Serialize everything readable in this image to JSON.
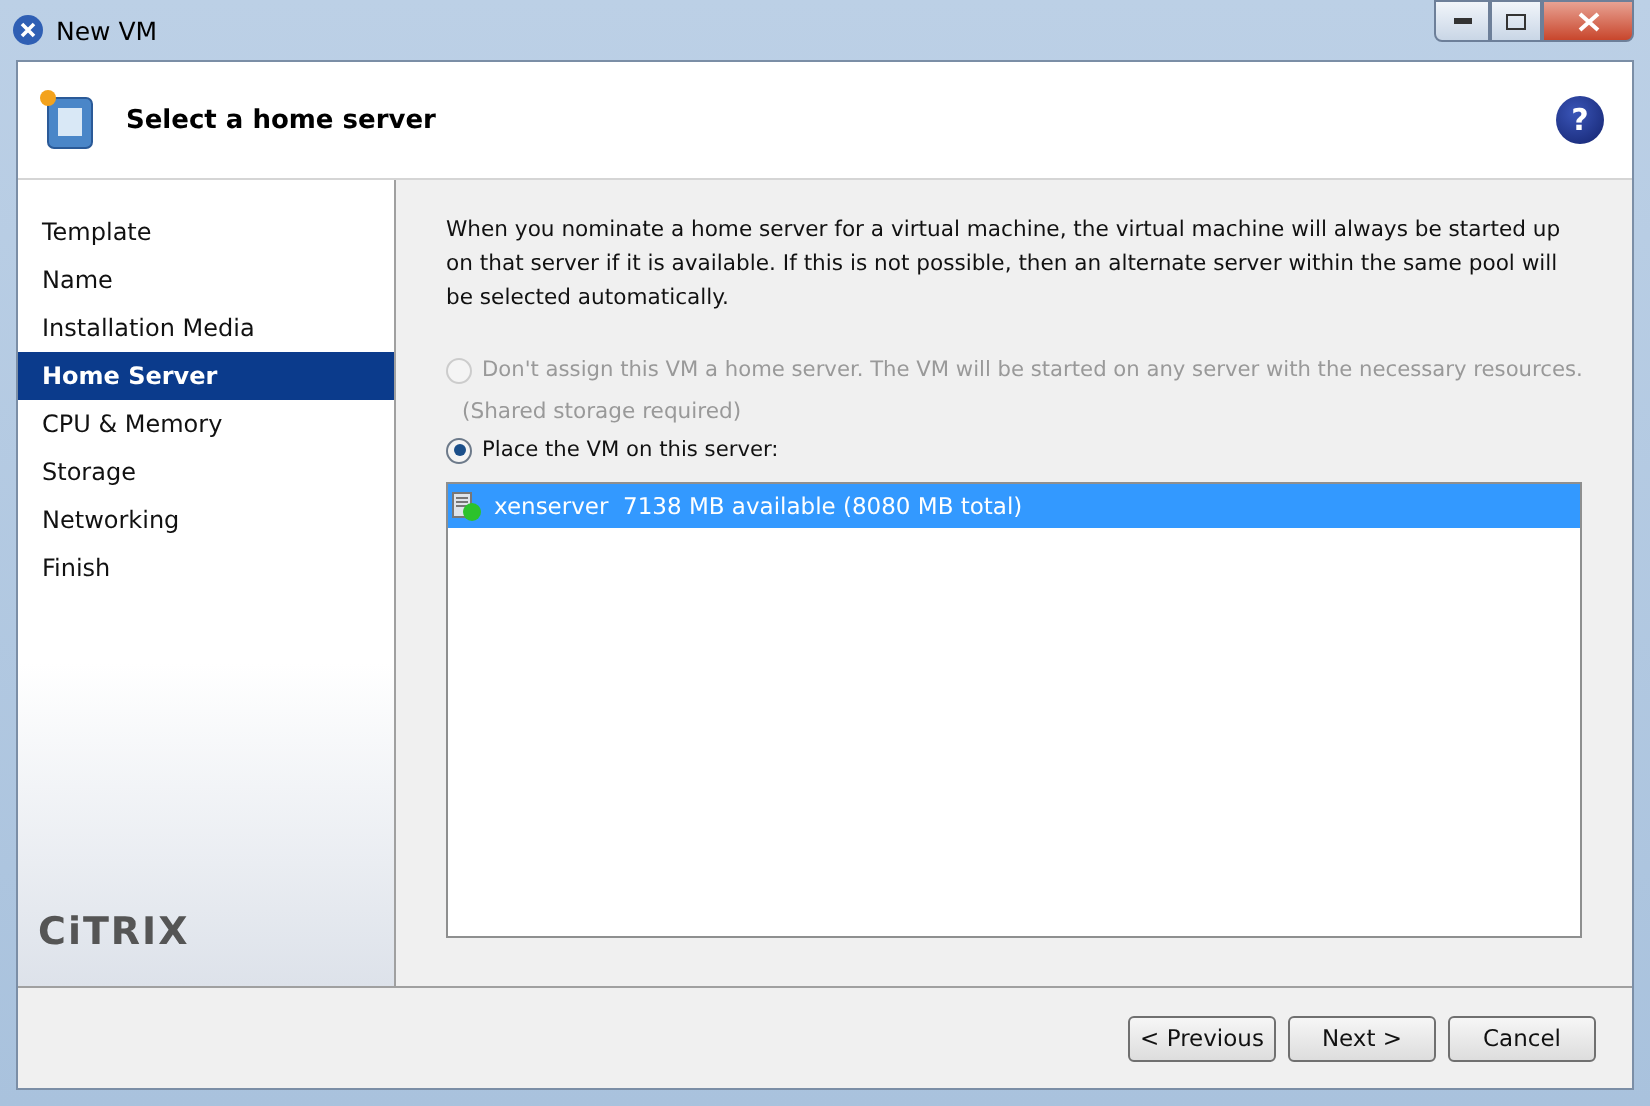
{
  "window": {
    "title": "New VM"
  },
  "header": {
    "title": "Select a home server",
    "help": "?"
  },
  "sidebar": {
    "items": [
      {
        "label": "Template",
        "selected": false
      },
      {
        "label": "Name",
        "selected": false
      },
      {
        "label": "Installation Media",
        "selected": false
      },
      {
        "label": "Home Server",
        "selected": true
      },
      {
        "label": "CPU & Memory",
        "selected": false
      },
      {
        "label": "Storage",
        "selected": false
      },
      {
        "label": "Networking",
        "selected": false
      },
      {
        "label": "Finish",
        "selected": false
      }
    ],
    "logo": "CiTRIX"
  },
  "content": {
    "description": "When you nominate a home server for a virtual machine, the virtual machine will always be started up on that server if it is available. If this is not possible, then an alternate server within the same pool will be selected automatically.",
    "options": [
      {
        "label": "Don't assign this VM a home server. The VM will be started on any server with the necessary resources.",
        "note": "(Shared storage required)",
        "selected": false,
        "disabled": true
      },
      {
        "label": "Place the VM on this server:",
        "selected": true,
        "disabled": false
      }
    ],
    "servers": [
      {
        "name": "xenserver",
        "memory": "7138 MB available (8080 MB total)",
        "selected": true
      }
    ]
  },
  "buttons": [
    "< Previous",
    "Next >",
    "Cancel"
  ]
}
